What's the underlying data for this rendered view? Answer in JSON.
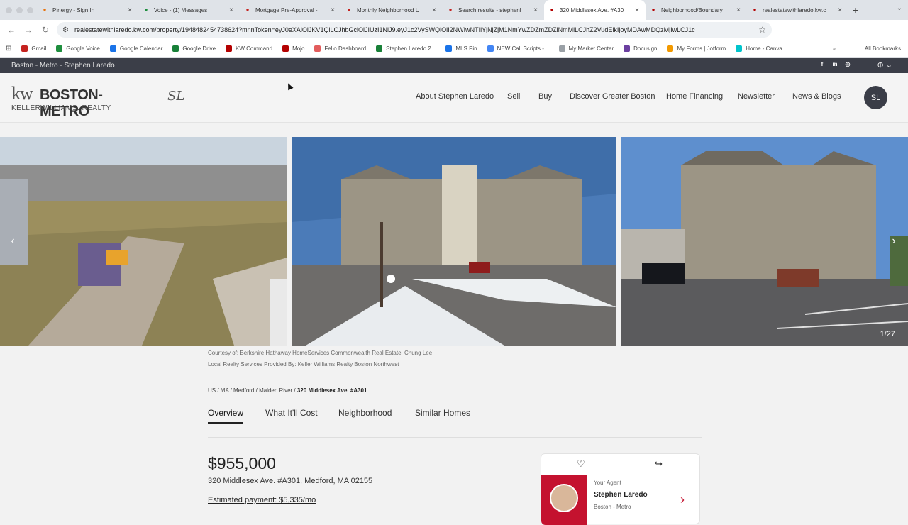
{
  "browser": {
    "tabs": [
      {
        "title": "Pinergy - Sign In",
        "icon": "pinergy-icon",
        "color": "#e8710a",
        "active": false
      },
      {
        "title": "Voice - (1) Messages",
        "icon": "google-voice-icon",
        "color": "#1e8e3e",
        "active": false
      },
      {
        "title": "Mortgage Pre-Approval -",
        "icon": "gmail-icon",
        "color": "#c5221f",
        "active": false
      },
      {
        "title": "Monthly Neighborhood U",
        "icon": "gmail-icon",
        "color": "#c5221f",
        "active": false
      },
      {
        "title": "Search results - stephenl",
        "icon": "gmail-icon",
        "color": "#c5221f",
        "active": false
      },
      {
        "title": "320 Middlesex Ave. #A30",
        "icon": "kw-icon",
        "color": "#b40101",
        "active": true
      },
      {
        "title": "Neighborhood/Boundary",
        "icon": "kw-icon",
        "color": "#b40101",
        "active": false
      },
      {
        "title": "realestatewithlaredo.kw.c",
        "icon": "kw-icon",
        "color": "#b40101",
        "active": false
      }
    ],
    "url": "realestatewithlaredo.kw.com/property/1948482454738624?mnnToken=eyJ0eXAiOiJKV1QiLCJhbGciOiJIUzI1NiJ9.eyJ1c2VySWQiOiI2NWIwNTIlYjNjZjM1NmYwZDZmZDZlNmMiLCJhZ2VudElkIjoyMDAwMDQzMjIwLCJ1c",
    "bookmarks": [
      {
        "label": "Gmail",
        "color": "#c5221f"
      },
      {
        "label": "Google Voice",
        "color": "#1e8e3e"
      },
      {
        "label": "Google Calendar",
        "color": "#1a73e8"
      },
      {
        "label": "Google Drive",
        "color": "#188038"
      },
      {
        "label": "KW Command",
        "color": "#b40101"
      },
      {
        "label": "Mojo",
        "color": "#b40101"
      },
      {
        "label": "Fello Dashboard",
        "color": "#e25c5c"
      },
      {
        "label": "Stephen Laredo 2...",
        "color": "#188038"
      },
      {
        "label": "MLS Pin",
        "color": "#1a73e8"
      },
      {
        "label": "NEW Call Scripts -...",
        "color": "#4285f4"
      },
      {
        "label": "My Market Center",
        "color": "#9aa0a6"
      },
      {
        "label": "Docusign",
        "color": "#6b3fa0"
      },
      {
        "label": "My Forms | Jotform",
        "color": "#f29900"
      },
      {
        "label": "Home - Canva",
        "color": "#00c4cc"
      }
    ],
    "all_bookmarks": "All Bookmarks"
  },
  "site": {
    "topbar_text": "Boston - Metro - Stephen Laredo",
    "logo_kw": "kw",
    "logo_city": "BOSTON-METRO",
    "logo_sub": "KELLERWILLIAMS. REALTY",
    "signature": "SL",
    "nav": [
      "About Stephen Laredo",
      "Sell",
      "Buy",
      "Discover Greater Boston",
      "Home Financing",
      "Newsletter",
      "News & Blogs"
    ],
    "avatar_initials": "SL"
  },
  "listing": {
    "photo_counter": "1/27",
    "courtesy": "Courtesy of: Berkshire Hathaway HomeServices Commonwealth Real Estate, Chung Lee",
    "local_services": "Local Realty Services Provided By: Keller Williams Realty Boston Northwest",
    "breadcrumb": [
      "US",
      "MA",
      "Medford",
      "Malden River"
    ],
    "breadcrumb_current": "320 Middlesex Ave. #A301",
    "tabs": [
      "Overview",
      "What It'll Cost",
      "Neighborhood",
      "Similar Homes"
    ],
    "price": "$955,000",
    "address": "320 Middlesex Ave. #A301, Medford, MA 02155",
    "estimated_payment": "Estimated payment: $5,335/mo"
  },
  "agent": {
    "label": "Your Agent",
    "name": "Stephen Laredo",
    "office": "Boston - Metro"
  }
}
